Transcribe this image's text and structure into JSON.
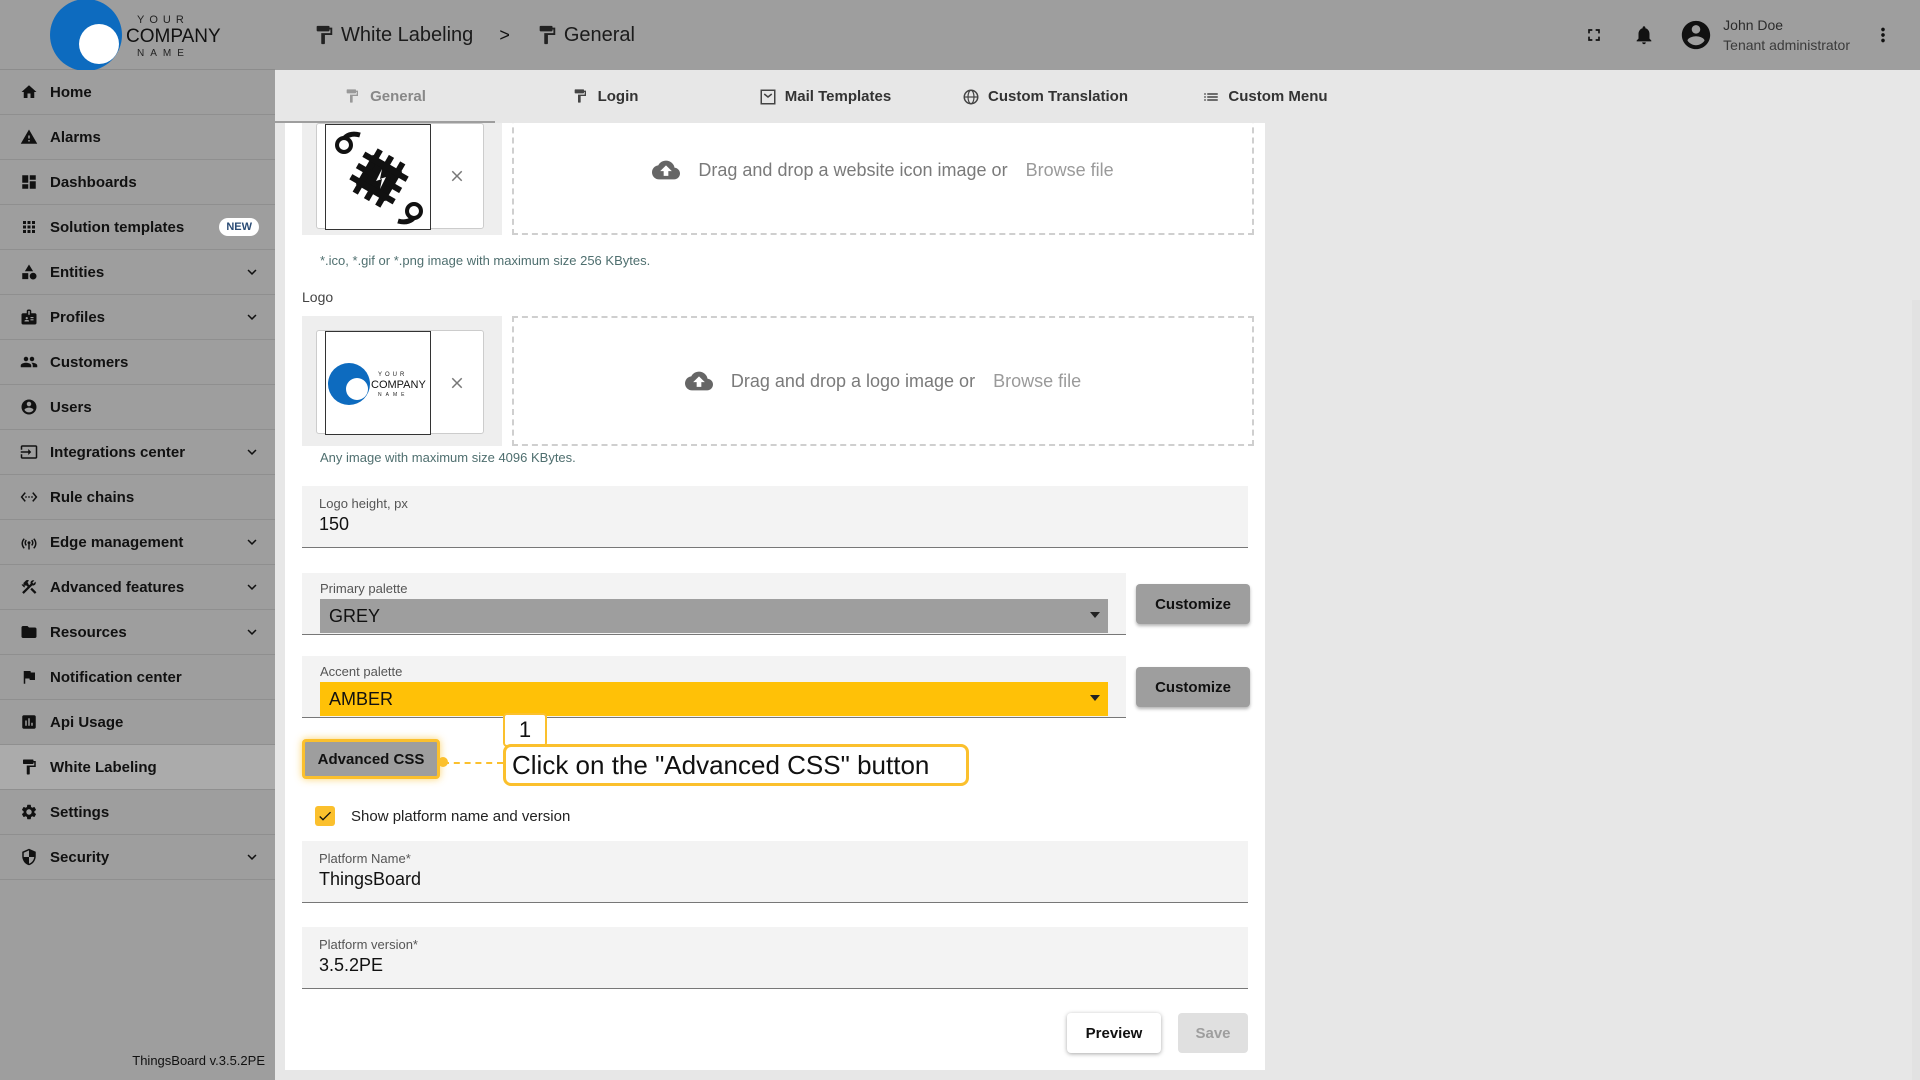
{
  "brand": {
    "logo_line1": "YOUR",
    "logo_line2": "COMPANY",
    "logo_line3": "NAME"
  },
  "sidebar": {
    "items": [
      {
        "label": "Home",
        "icon": "home-icon",
        "expandable": false,
        "active": false
      },
      {
        "label": "Alarms",
        "icon": "warning-icon",
        "expandable": false,
        "active": false
      },
      {
        "label": "Dashboards",
        "icon": "dashboard-icon",
        "expandable": false,
        "active": false
      },
      {
        "label": "Solution templates",
        "icon": "apps-icon",
        "expandable": false,
        "active": false,
        "badge": "NEW"
      },
      {
        "label": "Entities",
        "icon": "category-icon",
        "expandable": true,
        "active": false
      },
      {
        "label": "Profiles",
        "icon": "badge-icon",
        "expandable": true,
        "active": false
      },
      {
        "label": "Customers",
        "icon": "group-icon",
        "expandable": false,
        "active": false
      },
      {
        "label": "Users",
        "icon": "account-circle-icon",
        "expandable": false,
        "active": false
      },
      {
        "label": "Integrations center",
        "icon": "input-icon",
        "expandable": true,
        "active": false
      },
      {
        "label": "Rule chains",
        "icon": "settings-ethernet-icon",
        "expandable": false,
        "active": false
      },
      {
        "label": "Edge management",
        "icon": "router-icon",
        "expandable": true,
        "active": false
      },
      {
        "label": "Advanced features",
        "icon": "construction-icon",
        "expandable": true,
        "active": false
      },
      {
        "label": "Resources",
        "icon": "folder-icon",
        "expandable": true,
        "active": false
      },
      {
        "label": "Notification center",
        "icon": "flag-icon",
        "expandable": false,
        "active": false
      },
      {
        "label": "Api Usage",
        "icon": "insert-chart-icon",
        "expandable": false,
        "active": false
      },
      {
        "label": "White Labeling",
        "icon": "format-paint-icon",
        "expandable": false,
        "active": true
      },
      {
        "label": "Settings",
        "icon": "gear-icon",
        "expandable": false,
        "active": false
      },
      {
        "label": "Security",
        "icon": "security-icon",
        "expandable": true,
        "active": false
      }
    ],
    "version": "ThingsBoard v.3.5.2PE"
  },
  "header": {
    "breadcrumb": [
      {
        "label": "White Labeling"
      },
      {
        "label": "General"
      }
    ],
    "separator": ">",
    "user_name": "John Doe",
    "user_role": "Tenant administrator"
  },
  "tabs": [
    {
      "label": "General",
      "active": true
    },
    {
      "label": "Login",
      "active": false
    },
    {
      "label": "Mail Templates",
      "active": false
    },
    {
      "label": "Custom Translation",
      "active": false
    },
    {
      "label": "Custom Menu",
      "active": false
    }
  ],
  "form": {
    "favicon": {
      "drop_text": "Drag and drop a website icon image or",
      "browse": "Browse file",
      "hint": "*.ico, *.gif or *.png image with maximum size 256 KBytes."
    },
    "logo": {
      "label": "Logo",
      "drop_text": "Drag and drop a logo image or",
      "browse": "Browse file",
      "hint": "Any image with maximum size 4096 KBytes."
    },
    "logo_height": {
      "label": "Logo height, px",
      "value": "150"
    },
    "primary_palette": {
      "label": "Primary palette",
      "value": "GREY",
      "color": "#9e9e9e",
      "button": "Customize"
    },
    "accent_palette": {
      "label": "Accent palette",
      "value": "AMBER",
      "color": "#ffc107",
      "button": "Customize"
    },
    "advanced_css": "Advanced CSS",
    "show_platform": {
      "label": "Show platform name and version",
      "checked": true
    },
    "platform_name": {
      "label": "Platform Name*",
      "value": "ThingsBoard"
    },
    "platform_version": {
      "label": "Platform version*",
      "value": "3.5.2PE"
    },
    "preview": "Preview",
    "save": "Save"
  },
  "callout": {
    "step": "1",
    "text": "Click on the \"Advanced CSS\" button",
    "color": "#fbc02d"
  }
}
